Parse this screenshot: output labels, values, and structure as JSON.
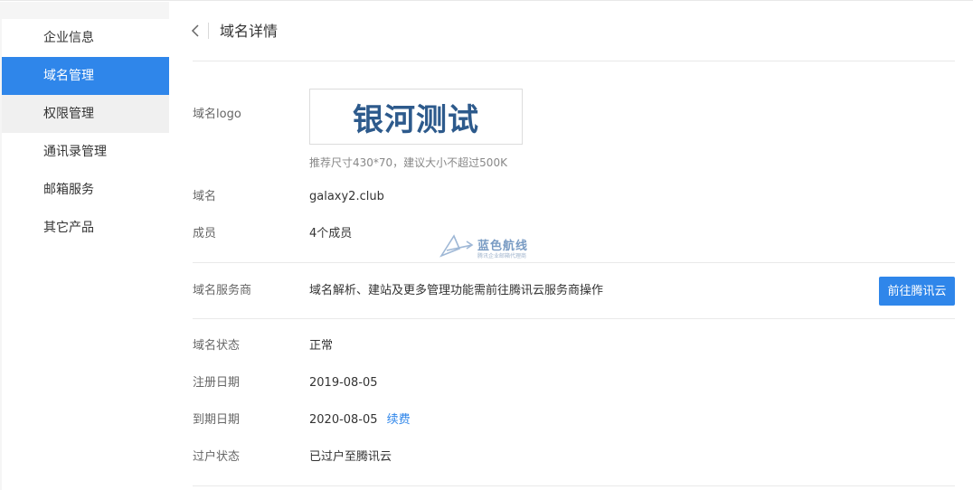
{
  "sidebar": {
    "items": [
      {
        "label": "企业信息"
      },
      {
        "label": "域名管理"
      },
      {
        "label": "权限管理"
      },
      {
        "label": "通讯录管理"
      },
      {
        "label": "邮箱服务"
      },
      {
        "label": "其它产品"
      }
    ]
  },
  "header": {
    "title": "域名详情"
  },
  "logo": {
    "label": "域名logo",
    "image_text": "银河测试",
    "hint": "推荐尺寸430*70，建议大小不超过500K"
  },
  "domain": {
    "label": "域名",
    "value": "galaxy2.club"
  },
  "members": {
    "label": "成员",
    "value": "4个成员"
  },
  "provider": {
    "label": "域名服务商",
    "value": "域名解析、建站及更多管理功能需前往腾讯云服务商操作",
    "button": "前往腾讯云"
  },
  "status": {
    "label": "域名状态",
    "value": "正常"
  },
  "register_date": {
    "label": "注册日期",
    "value": "2019-08-05"
  },
  "expire_date": {
    "label": "到期日期",
    "value": "2020-08-05",
    "renew": "续费"
  },
  "transfer": {
    "label": "过户状态",
    "value": "已过户至腾讯云"
  },
  "watermark": {
    "title": "蓝色航线",
    "subtitle": "腾讯企业邮箱代理商"
  },
  "colors": {
    "accent": "#2f86ea",
    "logo_text": "#2d5a8c"
  }
}
